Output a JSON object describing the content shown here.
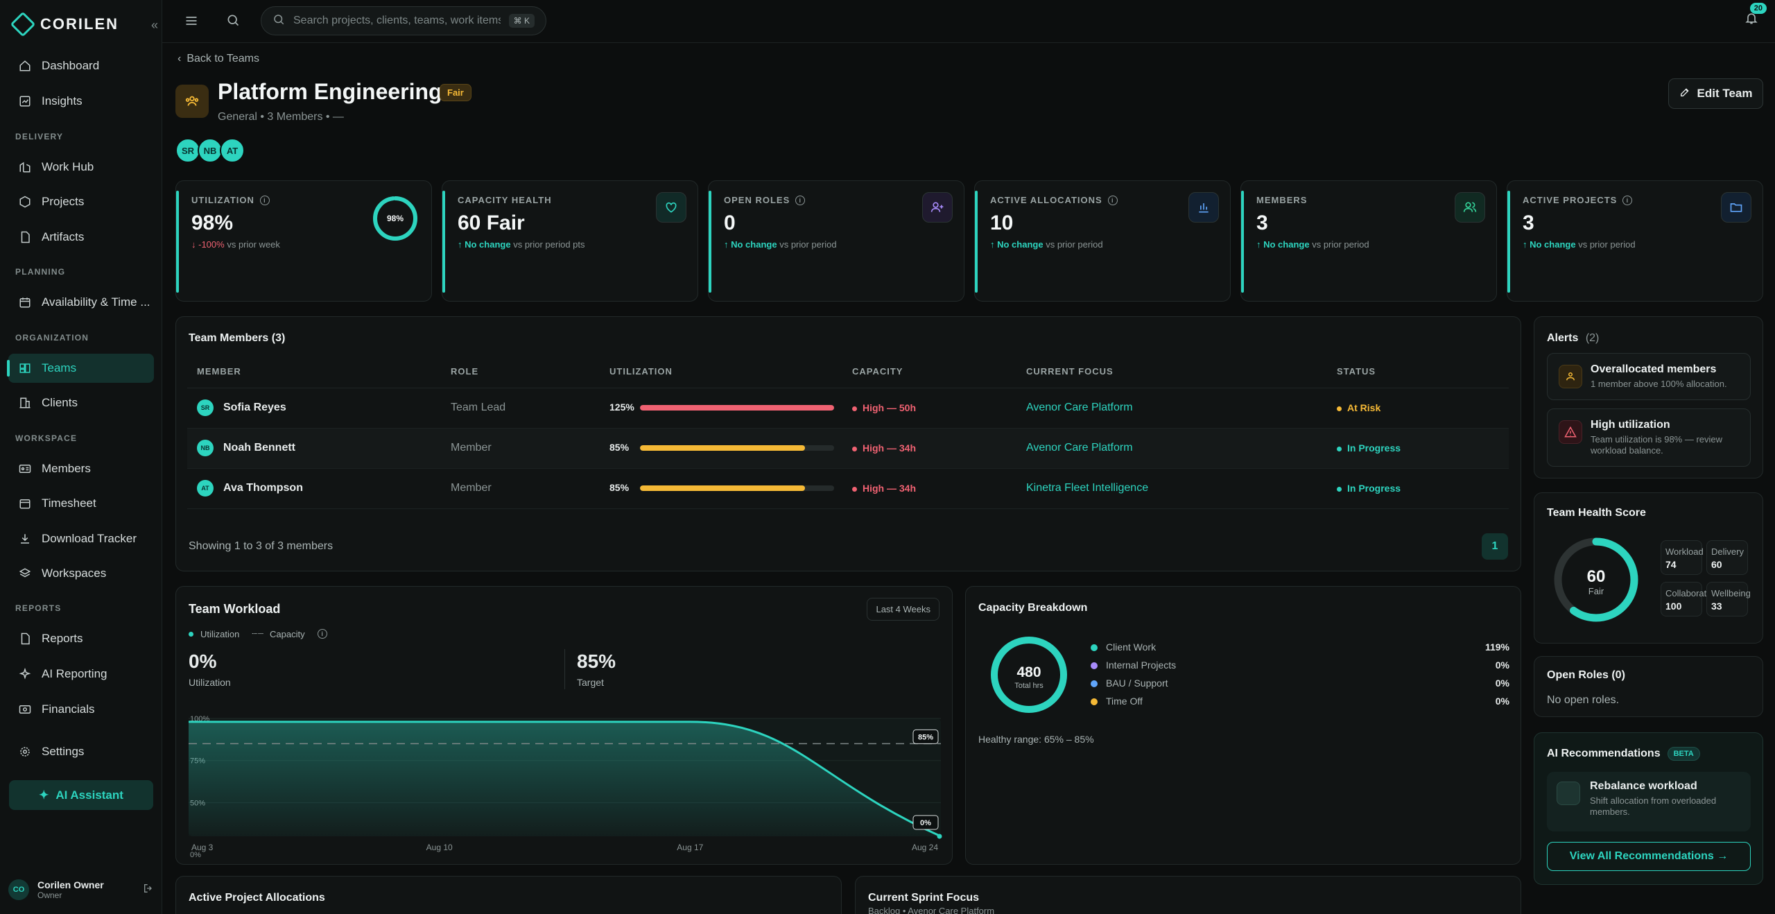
{
  "brand": {
    "name": "CORILEN"
  },
  "nav": {
    "dashboard": "Dashboard",
    "insights": "Insights",
    "sec_delivery": "DELIVERY",
    "work_hub": "Work Hub",
    "projects": "Projects",
    "artifacts": "Artifacts",
    "sec_planning": "PLANNING",
    "availability": "Availability & Time ...",
    "sec_org": "ORGANIZATION",
    "teams": "Teams",
    "clients": "Clients",
    "sec_workspace": "WORKSPACE",
    "members": "Members",
    "timesheet": "Timesheet",
    "download_tracker": "Download Tracker",
    "workspaces": "Workspaces",
    "sec_reports": "REPORTS",
    "reports": "Reports",
    "ai_reporting": "AI Reporting",
    "financials": "Financials",
    "settings": "Settings",
    "ai_assistant": "AI Assistant"
  },
  "user": {
    "initials": "CO",
    "name": "Corilen Owner",
    "role": "Owner"
  },
  "search": {
    "placeholder": "Search projects, clients, teams, work items",
    "shortcut": "⌘ K"
  },
  "notifications": {
    "count": "20"
  },
  "header": {
    "back": "Back to Teams",
    "title": "Platform Engineering",
    "badge": "Fair",
    "meta": "General • 3 Members • —",
    "edit": "Edit Team",
    "avatars": [
      "SR",
      "NB",
      "AT"
    ]
  },
  "kpis": {
    "utilization": {
      "label": "UTILIZATION",
      "value": "98%",
      "delta": "↓ -100%",
      "suffix": "vs prior week",
      "ring": "98%",
      "ring_fraction": 0.98
    },
    "capacity": {
      "label": "CAPACITY HEALTH",
      "value": "60 Fair",
      "delta": "↑ No change",
      "suffix": "vs prior period pts"
    },
    "open_roles": {
      "label": "OPEN ROLES",
      "value": "0",
      "delta": "↑ No change",
      "suffix": "vs prior period"
    },
    "allocations": {
      "label": "ACTIVE ALLOCATIONS",
      "value": "10",
      "delta": "↑ No change",
      "suffix": "vs prior period"
    },
    "members": {
      "label": "MEMBERS",
      "value": "3",
      "delta": "↑ No change",
      "suffix": "vs prior period"
    },
    "projects": {
      "label": "ACTIVE PROJECTS",
      "value": "3",
      "delta": "↑ No change",
      "suffix": "vs prior period"
    }
  },
  "team_members": {
    "title": "Team Members (3)",
    "columns": [
      "MEMBER",
      "ROLE",
      "UTILIZATION",
      "CAPACITY",
      "CURRENT FOCUS",
      "STATUS"
    ],
    "rows": [
      {
        "initials": "SR",
        "name": "Sofia Reyes",
        "role": "Team Lead",
        "util": "125%",
        "util_fraction": 1.0,
        "bar_color": "#f06272",
        "capacity": "High — 50h",
        "focus": "Avenor Care Platform",
        "status": "At Risk",
        "status_color": "#f5b936"
      },
      {
        "initials": "NB",
        "name": "Noah Bennett",
        "role": "Member",
        "util": "85%",
        "util_fraction": 0.85,
        "bar_color": "#f5b936",
        "capacity": "High — 34h",
        "focus": "Avenor Care Platform",
        "status": "In Progress",
        "status_color": "#2dd4bf"
      },
      {
        "initials": "AT",
        "name": "Ava Thompson",
        "role": "Member",
        "util": "85%",
        "util_fraction": 0.85,
        "bar_color": "#f5b936",
        "capacity": "High — 34h",
        "focus": "Kinetra Fleet Intelligence",
        "status": "In Progress",
        "status_color": "#2dd4bf"
      }
    ],
    "footer": "Showing 1 to 3 of 3 members",
    "page": "1"
  },
  "alerts": {
    "title": "Alerts",
    "count": "(2)",
    "items": [
      {
        "title": "Overallocated members",
        "sub": "1 member above 100% allocation."
      },
      {
        "title": "High utilization",
        "sub": "Team utilization is 98% — review workload balance."
      }
    ]
  },
  "health": {
    "title": "Team Health Score",
    "value": "60",
    "label": "Fair",
    "fraction": 0.6,
    "metrics": [
      {
        "label": "Workload",
        "value": "74"
      },
      {
        "label": "Delivery",
        "value": "60"
      },
      {
        "label": "Collaboration",
        "value": "100"
      },
      {
        "label": "Wellbeing",
        "value": "33"
      }
    ]
  },
  "open_roles": {
    "title": "Open Roles (0)",
    "empty": "No open roles."
  },
  "ai_rec": {
    "title": "AI Recommendations",
    "beta": "BETA",
    "item_title": "Rebalance workload",
    "item_sub": "Shift allocation from overloaded members.",
    "view_all": "View All Recommendations →"
  },
  "workload": {
    "title": "Team Workload",
    "range": "Last 4 Weeks",
    "legend_util": "Utilization",
    "legend_cap": "Capacity",
    "util_value": "0%",
    "util_label": "Utilization",
    "target_value": "85%",
    "target_label": "Target"
  },
  "chart_data": {
    "type": "area",
    "title": "Team Workload",
    "x": [
      "Aug 3",
      "Aug 10",
      "Aug 17",
      "Aug 24"
    ],
    "series": [
      {
        "name": "Utilization",
        "values": [
          98,
          98,
          98,
          0
        ],
        "color": "#2dd4bf"
      },
      {
        "name": "Capacity",
        "values": [
          85,
          85,
          85,
          85
        ],
        "style": "dashed"
      }
    ],
    "y_ticks": [
      "100%",
      "75%",
      "50%",
      "0%"
    ],
    "annotations": [
      {
        "label": "85%"
      },
      {
        "label": "0%"
      }
    ],
    "grid": true
  },
  "capacity": {
    "title": "Capacity Breakdown",
    "total": "480",
    "total_label": "Total hrs",
    "items": [
      {
        "label": "Client Work",
        "value": "119%",
        "color": "#2dd4bf"
      },
      {
        "label": "Internal Projects",
        "value": "0%",
        "color": "#a78bfa"
      },
      {
        "label": "BAU / Support",
        "value": "0%",
        "color": "#60a5fa"
      },
      {
        "label": "Time Off",
        "value": "0%",
        "color": "#f5b936"
      }
    ],
    "healthy": "Healthy range: 65% – 85%"
  },
  "bottom": {
    "allocations_title": "Active Project Allocations",
    "sprint_title": "Current Sprint Focus",
    "sprint_sub": "Backlog • Avenor Care Platform"
  }
}
